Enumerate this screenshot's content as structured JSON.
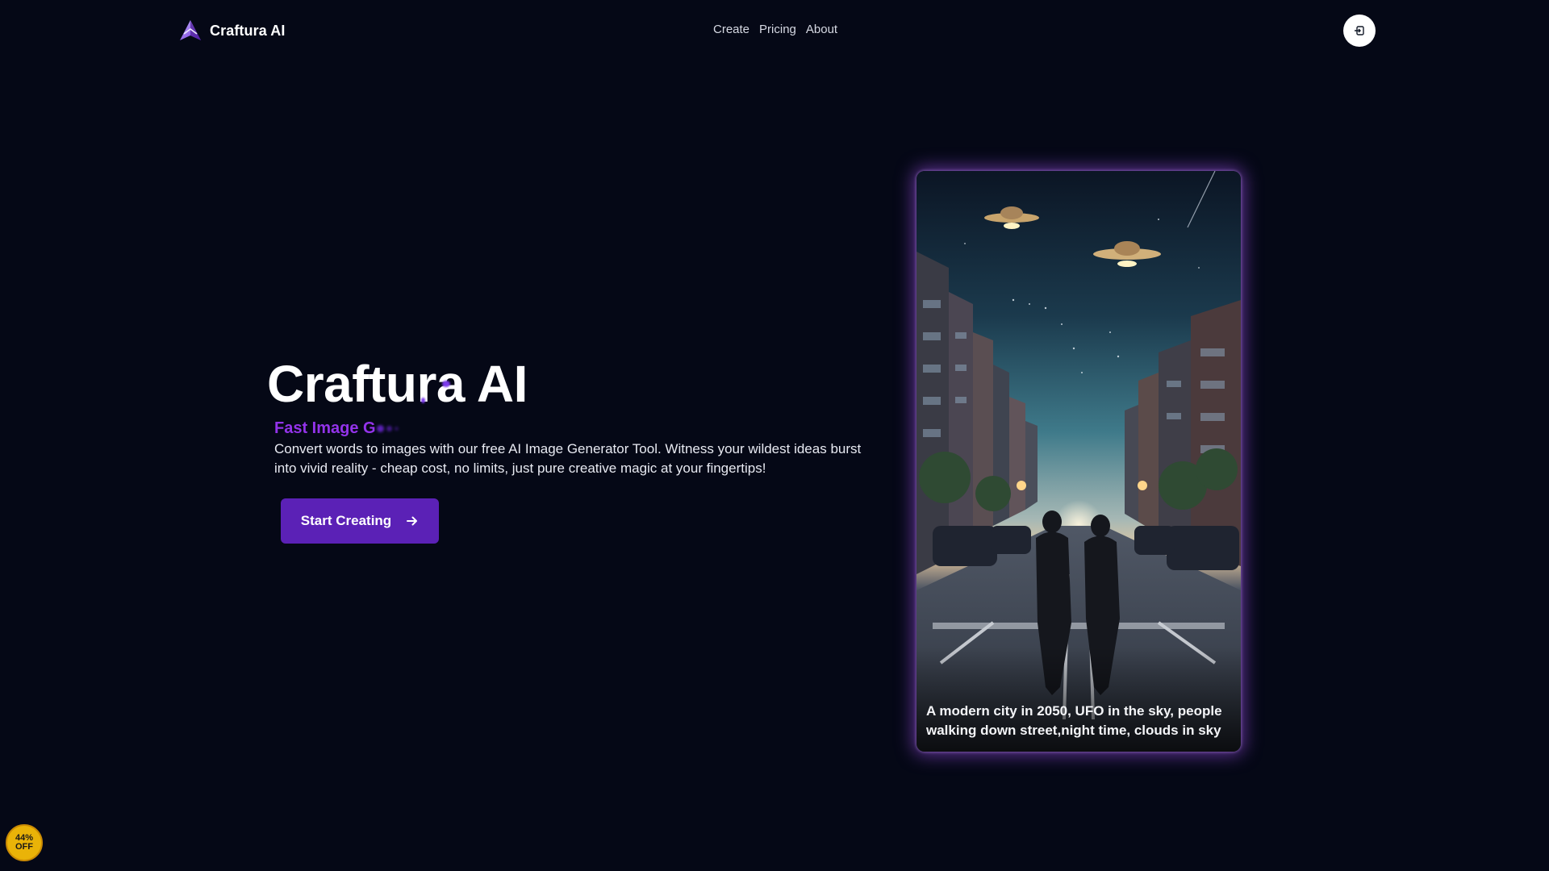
{
  "header": {
    "brand_name": "Craftura AI",
    "nav": [
      {
        "label": "Create"
      },
      {
        "label": "Pricing"
      },
      {
        "label": "About"
      }
    ],
    "login_icon": "login-icon"
  },
  "hero": {
    "title": "Craftura AI",
    "subtitle_typed": "Fast Image G",
    "description": "Convert words to images with our free AI Image Generator Tool. Witness your wildest ideas burst into vivid reality - cheap cost, no limits, just pure creative magic at your fingertips!",
    "cta_label": "Start Creating",
    "cta_icon": "arrow-right-icon"
  },
  "showcase": {
    "caption": "A modern city in 2050, UFO in the sky, people walking down street,night time, clouds in sky"
  },
  "discount_badge": {
    "line1": "44%",
    "line2": "OFF"
  },
  "colors": {
    "background": "#050816",
    "accent": "#5b21b6",
    "subtitle": "#9333ea",
    "glow": "#a855f7",
    "badge": "#eab308"
  }
}
